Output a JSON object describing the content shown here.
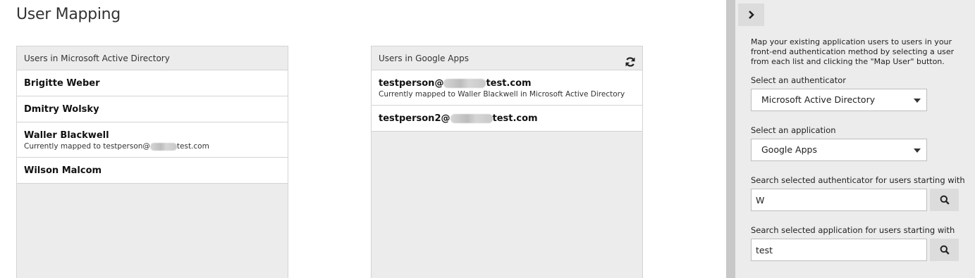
{
  "page": {
    "title": "User Mapping"
  },
  "left_panel": {
    "header": "Users in Microsoft Active Directory",
    "users": [
      {
        "name": "Brigitte Weber",
        "mapped_note": ""
      },
      {
        "name": "Dmitry Wolsky",
        "mapped_note": ""
      },
      {
        "name": "Waller Blackwell",
        "mapped_prefix": "Currently mapped to testperson@",
        "mapped_suffix": "test.com"
      },
      {
        "name": "Wilson Malcom",
        "mapped_note": ""
      }
    ]
  },
  "right_panel": {
    "header": "Users in Google Apps",
    "refresh_icon": "refresh-icon",
    "users": [
      {
        "name_prefix": "testperson@",
        "name_suffix": "test.com",
        "mapped_note": "Currently mapped to Waller Blackwell in Microsoft Active Directory"
      },
      {
        "name_prefix": "testperson2@",
        "name_suffix": "test.com",
        "mapped_note": ""
      }
    ]
  },
  "sidebar": {
    "collapse_icon": "chevron-right-icon",
    "help_text": "Map your existing application users to users in your front-end authentication method by selecting a user from each list and clicking the \"Map User\" button.",
    "authenticator_label": "Select an authenticator",
    "authenticator_value": "Microsoft Active Directory",
    "application_label": "Select an application",
    "application_value": "Google Apps",
    "auth_search_label": "Search selected authenticator for users starting with",
    "auth_search_value": "W",
    "app_search_label": "Search selected application for users starting with",
    "app_search_value": "test",
    "search_icon": "search-icon"
  }
}
